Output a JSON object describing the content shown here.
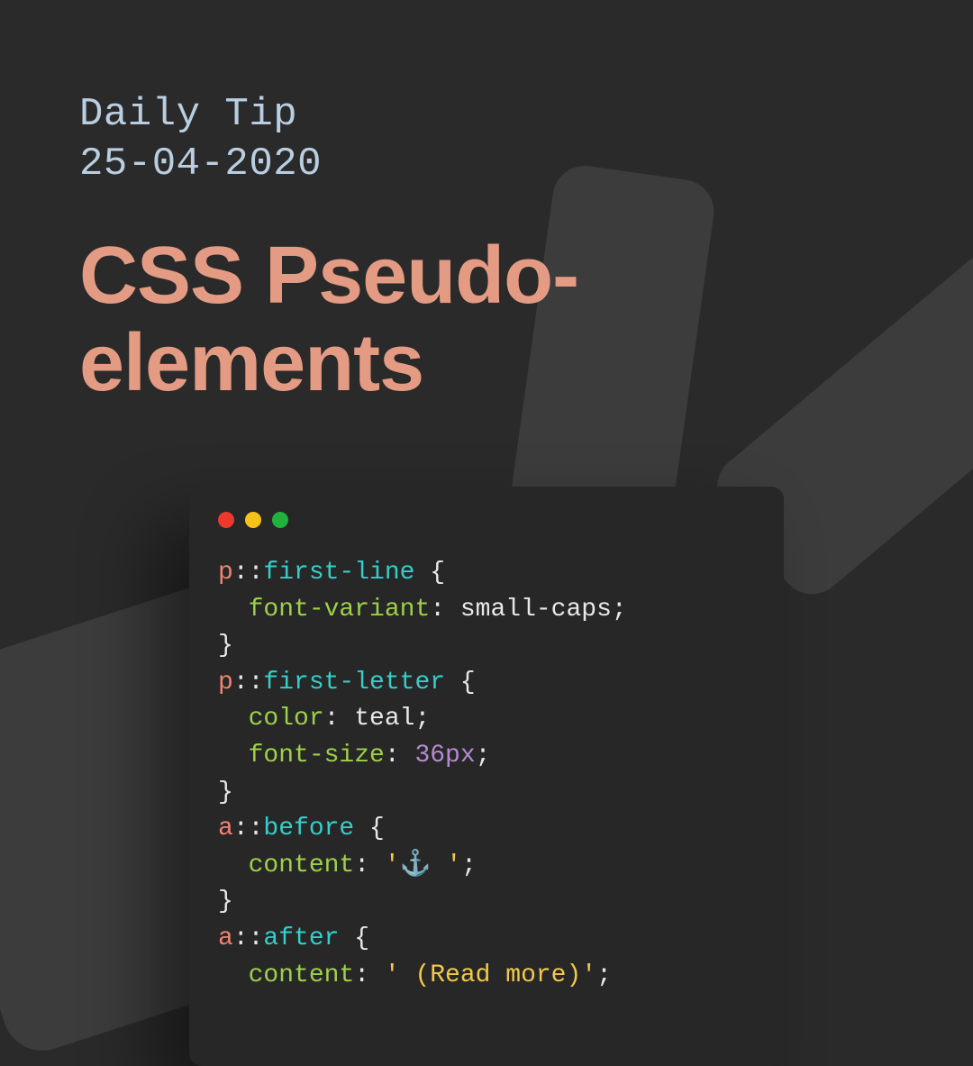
{
  "header": {
    "kicker_line1": "Daily Tip",
    "kicker_line2": "25-04-2020",
    "title_line1": "CSS Pseudo-",
    "title_line2": "elements"
  },
  "code": {
    "r1": {
      "tag": "p",
      "colons": "::",
      "sel": "first-line",
      "open": " {"
    },
    "r2": {
      "indent": "  ",
      "prop": "font-variant",
      "colon": ": ",
      "val": "small-caps",
      "semi": ";"
    },
    "r3": {
      "close": "}"
    },
    "r4": {
      "tag": "p",
      "colons": "::",
      "sel": "first-letter",
      "open": " {"
    },
    "r5": {
      "indent": "  ",
      "prop": "color",
      "colon": ": ",
      "val": "teal",
      "semi": ";"
    },
    "r6": {
      "indent": "  ",
      "prop": "font-size",
      "colon": ": ",
      "num": "36px",
      "semi": ";"
    },
    "r7": {
      "close": "}"
    },
    "r8": {
      "tag": "a",
      "colons": "::",
      "sel": "before",
      "open": " {"
    },
    "r9": {
      "indent": "  ",
      "prop": "content",
      "colon": ": ",
      "str": "'⚓ '",
      "semi": ";"
    },
    "r10": {
      "close": "}"
    },
    "r11": {
      "tag": "a",
      "colons": "::",
      "sel": "after",
      "open": " {"
    },
    "r12": {
      "indent": "  ",
      "prop": "content",
      "colon": ": ",
      "str": "' (Read more)'",
      "semi": ";"
    }
  }
}
